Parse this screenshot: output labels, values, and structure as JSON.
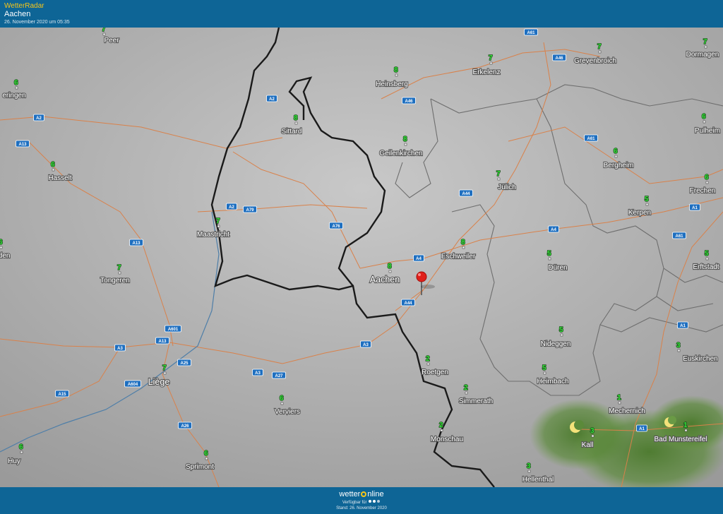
{
  "header": {
    "brand": "WetterRadar",
    "location": "Aachen",
    "datetime": "26. November 2020 um 05:35"
  },
  "footer": {
    "logo_left": "wetter",
    "logo_right": "nline",
    "availability": "Verfügbar für",
    "stand": "Stand: 26. November 2020"
  },
  "colors": {
    "header_bg": "#0e6596",
    "brand": "#f7c619",
    "map_bg": "#9e9e9e",
    "road_line": "#d9814a",
    "road_badge": "#1e6fc0",
    "border": "#1a1a1a",
    "temperature": "#35e33a",
    "marker": "#e0201b"
  },
  "marker": {
    "name": "location-pin",
    "color": "#e0201b"
  },
  "cities": [
    {
      "name": "Peer",
      "temp": "7"
    },
    {
      "name": "eringen",
      "temp": "6"
    },
    {
      "name": "Hasselt",
      "temp": "6"
    },
    {
      "name": "iden",
      "temp": "6"
    },
    {
      "name": "Tongeren",
      "temp": "7"
    },
    {
      "name": "Maastricht",
      "temp": "7"
    },
    {
      "name": "Sittard",
      "temp": "8"
    },
    {
      "name": "Heinsberg",
      "temp": "8"
    },
    {
      "name": "Geilenkirchen",
      "temp": "8"
    },
    {
      "name": "Erkelenz",
      "temp": "7"
    },
    {
      "name": "Grevenbroich",
      "temp": "7"
    },
    {
      "name": "Dormagen",
      "temp": "7"
    },
    {
      "name": "Pulheim",
      "temp": "6"
    },
    {
      "name": "Bergheim",
      "temp": "6"
    },
    {
      "name": "Frechen",
      "temp": "6"
    },
    {
      "name": "Kerpen",
      "temp": "5"
    },
    {
      "name": "Erftstadt",
      "temp": "5"
    },
    {
      "name": "Jülich",
      "temp": "7"
    },
    {
      "name": "Eschweiler",
      "temp": "8"
    },
    {
      "name": "Aachen",
      "temp": "8"
    },
    {
      "name": "Düren",
      "temp": "5"
    },
    {
      "name": "Nideggen",
      "temp": "5"
    },
    {
      "name": "Heimbach",
      "temp": "5"
    },
    {
      "name": "Roetgen",
      "temp": "2"
    },
    {
      "name": "Simmerath",
      "temp": "2"
    },
    {
      "name": "Monschau",
      "temp": "2"
    },
    {
      "name": "Euskirchen",
      "temp": "3"
    },
    {
      "name": "Mechernich",
      "temp": "1"
    },
    {
      "name": "Kall",
      "temp": "3"
    },
    {
      "name": "Bad Munstereifel",
      "temp": "1"
    },
    {
      "name": "Hellenthal",
      "temp": "3"
    },
    {
      "name": "Liège",
      "temp": "7"
    },
    {
      "name": "Verviers",
      "temp": "6"
    },
    {
      "name": "Sprimont",
      "temp": "6"
    },
    {
      "name": "Huy",
      "temp": "6"
    }
  ],
  "roads": [
    "A61",
    "A46",
    "A46",
    "A2",
    "A2",
    "A13",
    "A2",
    "A79",
    "A76",
    "A44",
    "A4",
    "A4",
    "A61",
    "A1",
    "A61",
    "A1",
    "A13",
    "A601",
    "A3",
    "A13",
    "A25",
    "A3",
    "A27",
    "A3",
    "A44",
    "A604",
    "A15",
    "A26",
    "A1"
  ]
}
